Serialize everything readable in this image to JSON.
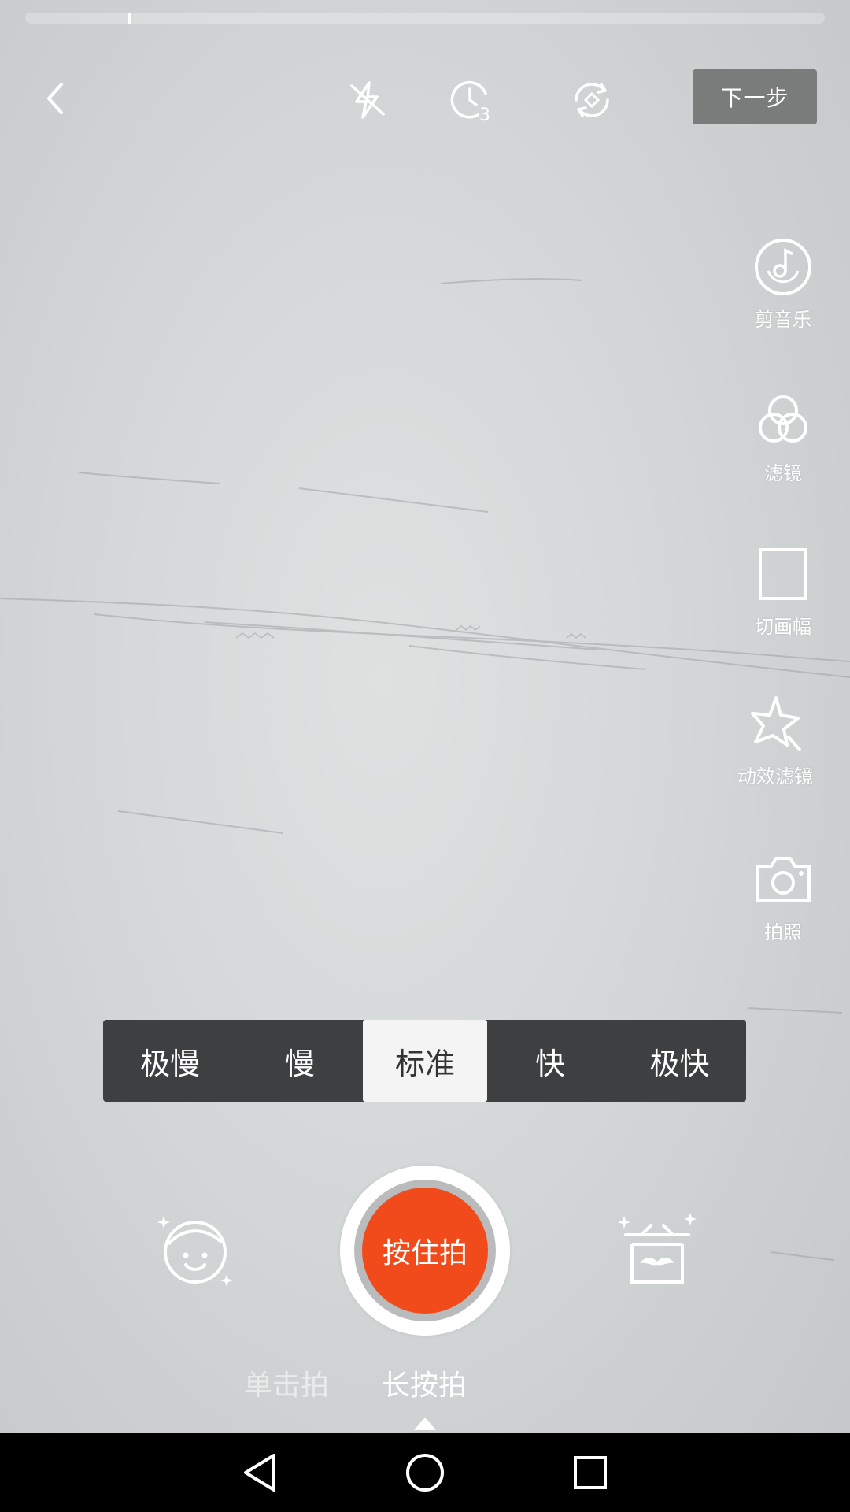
{
  "recording": {
    "progress": 0.13
  },
  "top_bar": {
    "back_icon": "chevron-left-icon",
    "flash_icon": "flash-off-icon",
    "timer_icon": "timer-3s-icon",
    "flip_icon": "camera-flip-icon",
    "next_label": "下一步"
  },
  "side_tools": {
    "music_label": "剪音乐",
    "filter_label": "滤镜",
    "crop_label": "切画幅",
    "dynamic_filter_label": "动效滤镜",
    "photo_label": "拍照"
  },
  "speed": {
    "options": [
      "极慢",
      "慢",
      "标准",
      "快",
      "极快"
    ],
    "selected": "标准"
  },
  "capture": {
    "shutter_label": "按住拍",
    "beauty_icon": "beauty-face-icon",
    "props_icon": "mustache-props-icon"
  },
  "modes": {
    "tap_label": "单击拍",
    "hold_label": "长按拍",
    "selected": "长按拍"
  },
  "nav": {
    "back_icon": "nav-back-icon",
    "home_icon": "nav-home-icon",
    "recent_icon": "nav-recent-icon"
  },
  "colors": {
    "shutter": "#f24b1b",
    "speed_bar": "#3d3f41",
    "next_button": "#7a7b7b"
  }
}
